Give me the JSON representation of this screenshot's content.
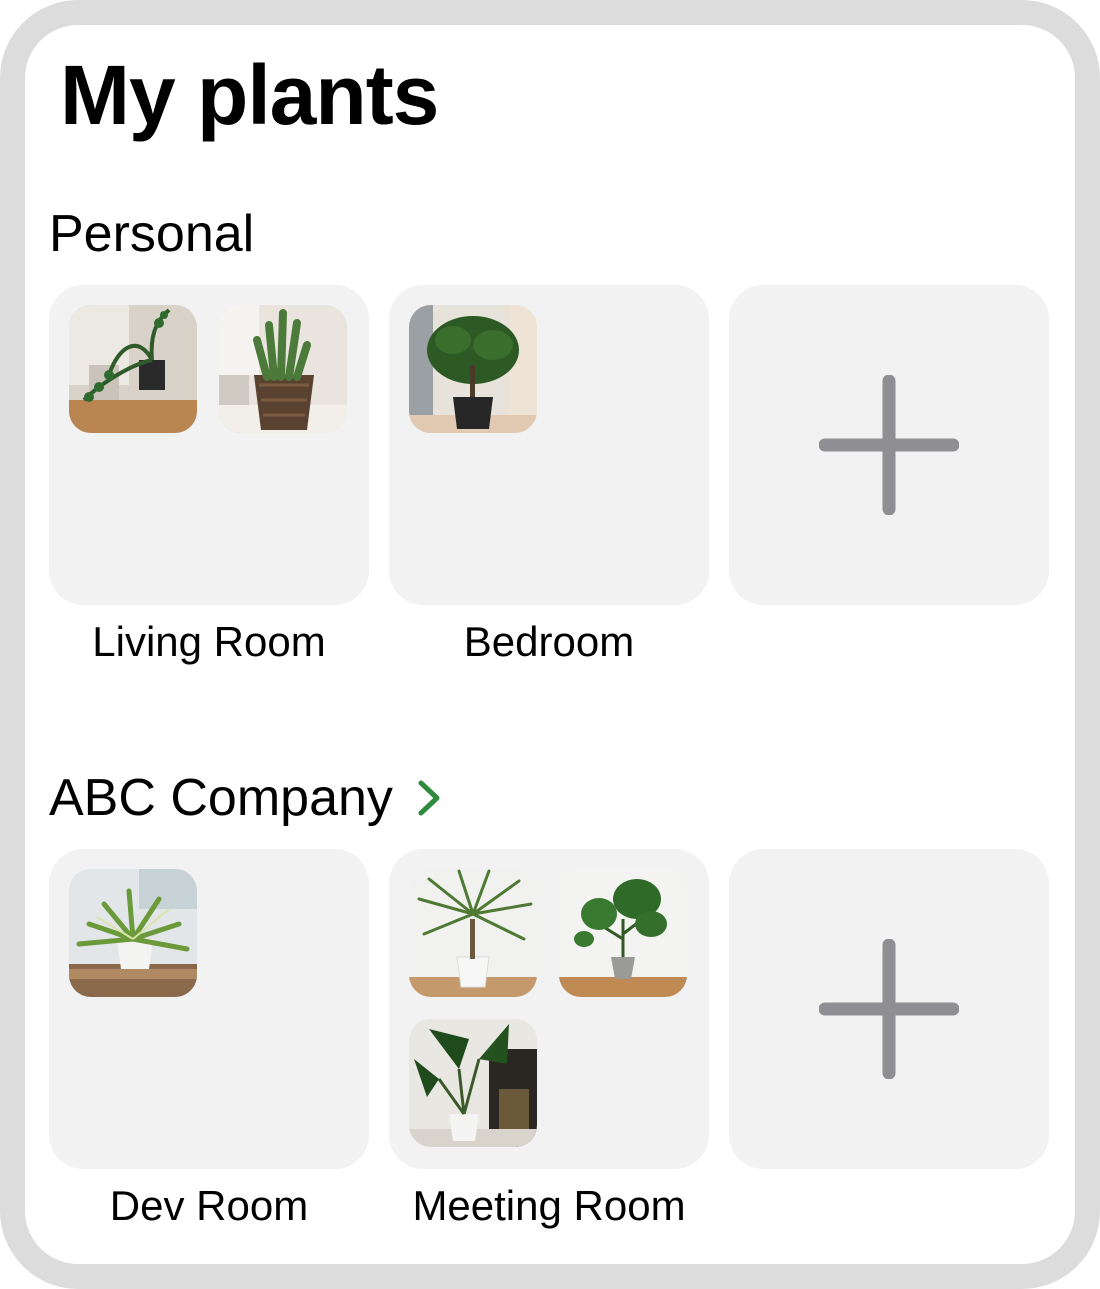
{
  "page": {
    "title": "My plants"
  },
  "sections": [
    {
      "title": "Personal",
      "has_chevron": false,
      "rooms": [
        {
          "label": "Living Room",
          "plants": [
            "zz-plant",
            "snake-plant-basket"
          ]
        },
        {
          "label": "Bedroom",
          "plants": [
            "ficus-tree"
          ]
        },
        {
          "label": "",
          "add_tile": true,
          "icon": "plus-icon"
        }
      ]
    },
    {
      "title": "ABC Company",
      "has_chevron": true,
      "chevron_icon": "chevron-right-icon",
      "chevron_color": "#2e8b3e",
      "rooms": [
        {
          "label": "Dev Room",
          "plants": [
            "spider-plant"
          ]
        },
        {
          "label": "Meeting Room",
          "plants": [
            "dracaena",
            "monstera",
            "alocasia"
          ]
        },
        {
          "label": "",
          "add_tile": true,
          "icon": "plus-icon"
        }
      ]
    }
  ],
  "colors": {
    "frame": "#dcdcdc",
    "tile": "#f2f2f2",
    "plus": "#8e8e93",
    "accent_green": "#2e8b3e"
  }
}
